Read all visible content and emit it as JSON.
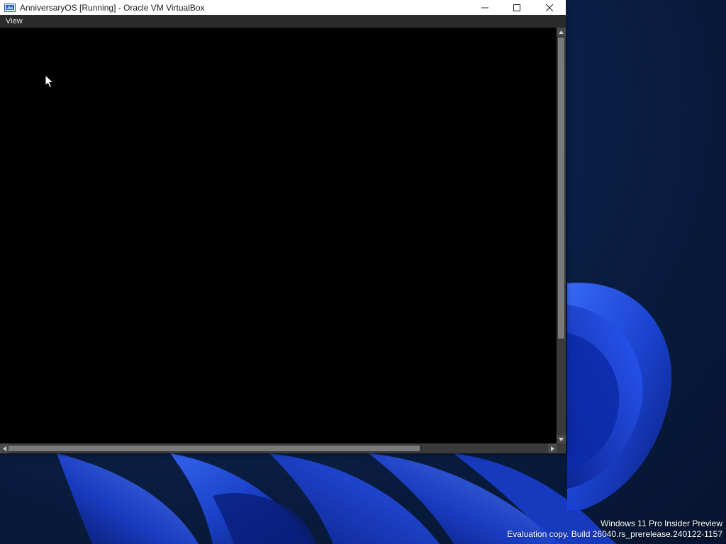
{
  "window": {
    "title": "AnniversaryOS [Running] - Oracle VM VirtualBox",
    "app_icon": "virtualbox-icon"
  },
  "caption_buttons": {
    "minimize": "minimize-icon",
    "maximize": "maximize-icon",
    "close": "close-icon"
  },
  "menubar": {
    "items": [
      {
        "label": "View"
      }
    ]
  },
  "vm_display": {
    "background": "#000000"
  },
  "desktop": {
    "watermark_line1": "Windows 11 Pro Insider Preview",
    "watermark_line2": "Evaluation copy. Build 26040.rs_prerelease.240122-1157"
  },
  "colors": {
    "accent_blue": "#1e4fd6",
    "menubar_bg": "#2b2b2b",
    "titlebar_bg": "#ffffff"
  }
}
